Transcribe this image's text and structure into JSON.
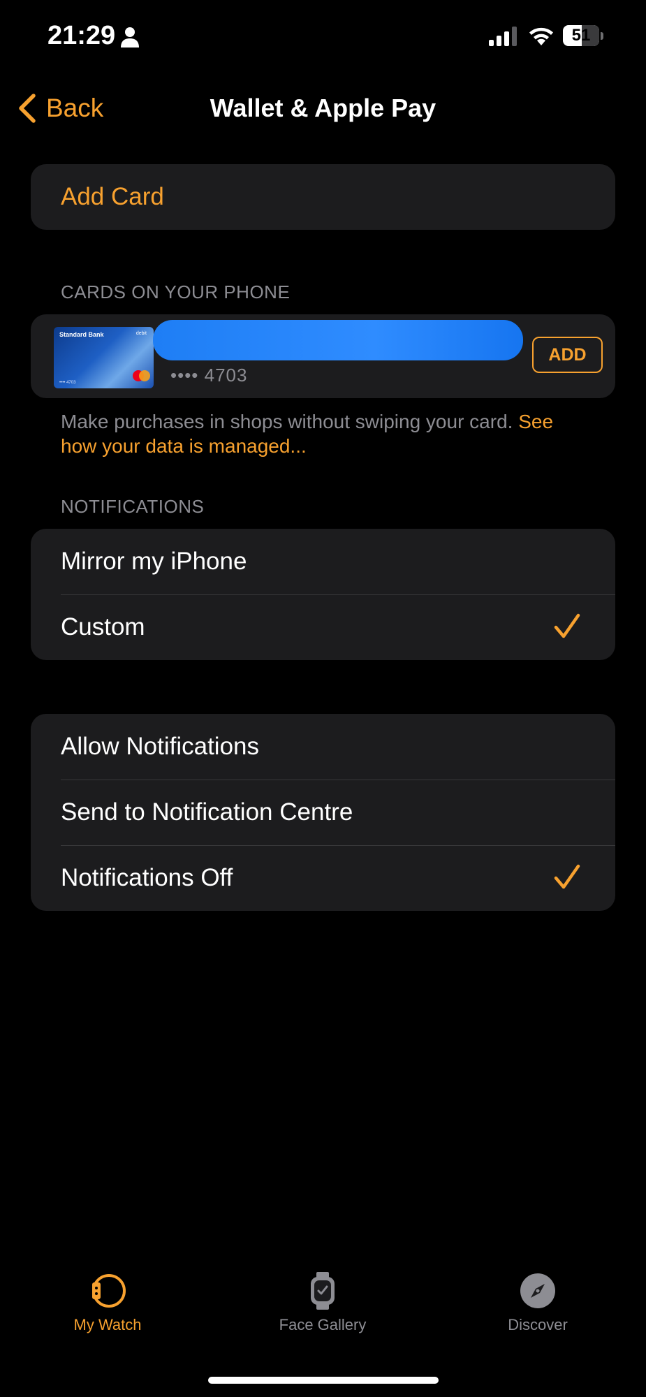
{
  "status_bar": {
    "time": "21:29",
    "battery": "51",
    "battery_level": 0.51
  },
  "nav": {
    "back_label": "Back",
    "title": "Wallet & Apple Pay"
  },
  "add_card": {
    "label": "Add Card"
  },
  "cards_section": {
    "header": "CARDS ON YOUR PHONE",
    "card": {
      "bank": "Standard Bank",
      "type": "debit",
      "number_masked": "•••• 4703",
      "thumb_number": "•••• 4703",
      "add_label": "ADD"
    },
    "footer_text": "Make purchases in shops without swiping your card.",
    "footer_link": "See how your data is managed..."
  },
  "notifications_section": {
    "header": "NOTIFICATIONS",
    "mode_options": [
      {
        "label": "Mirror my iPhone",
        "checked": false
      },
      {
        "label": "Custom",
        "checked": true
      }
    ],
    "custom_options": [
      {
        "label": "Allow Notifications",
        "checked": false
      },
      {
        "label": "Send to Notification Centre",
        "checked": false
      },
      {
        "label": "Notifications Off",
        "checked": true
      }
    ]
  },
  "tab_bar": {
    "tabs": [
      {
        "label": "My Watch",
        "icon": "watch-icon",
        "active": true
      },
      {
        "label": "Face Gallery",
        "icon": "watch-face-icon",
        "active": false
      },
      {
        "label": "Discover",
        "icon": "compass-icon",
        "active": false
      }
    ]
  },
  "colors": {
    "accent": "#f7a12f",
    "background": "#000000",
    "group": "#1c1c1e",
    "secondary_text": "#8d8d93"
  }
}
